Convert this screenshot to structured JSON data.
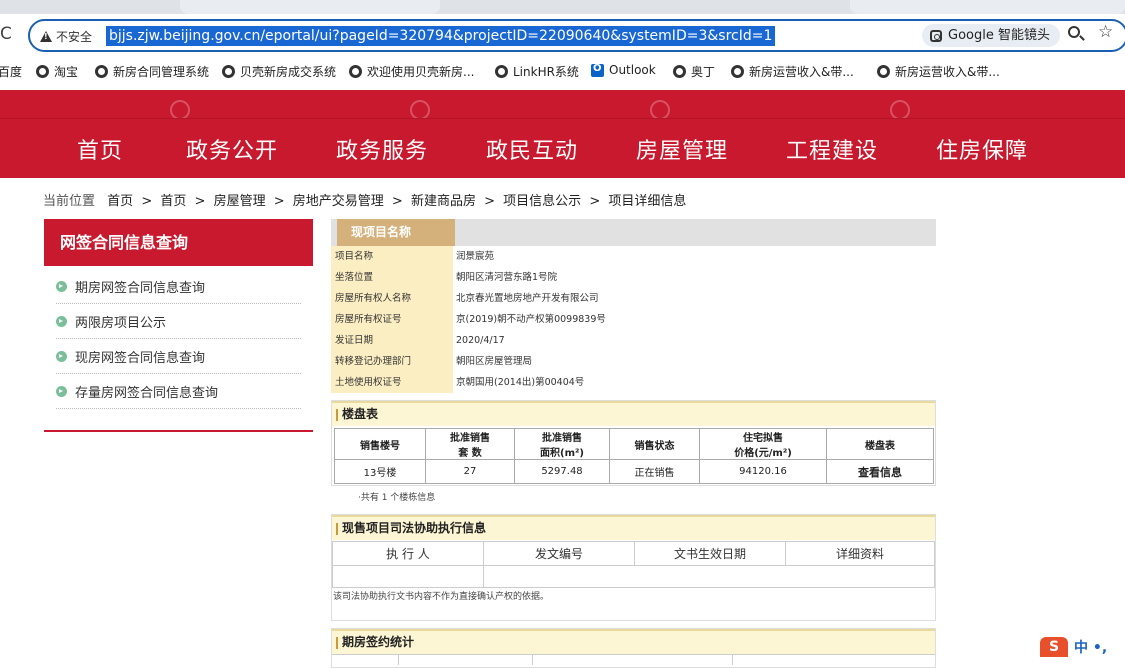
{
  "browser": {
    "security_label": "不安全",
    "url": "bjjs.zjw.beijing.gov.cn/eportal/ui?pageId=320794&projectID=22090640&systemID=3&srcId=1",
    "lens_label": "Google 智能镜头",
    "bookmarks": [
      "百度",
      "淘宝",
      "新房合同管理系统",
      "贝壳新房成交系统",
      "欢迎使用贝壳新房...",
      "LinkHR系统",
      "Outlook",
      "奥丁",
      "新房运营收入&带...",
      "新房运营收入&带..."
    ]
  },
  "nav": {
    "items": [
      "首页",
      "政务公开",
      "政务服务",
      "政民互动",
      "房屋管理",
      "工程建设",
      "住房保障"
    ]
  },
  "breadcrumb": {
    "prefix": "当前位置",
    "items": [
      "首页",
      ">",
      "首页",
      ">",
      "房屋管理",
      ">",
      "房地产交易管理",
      ">",
      "新建商品房",
      ">",
      "项目信息公示",
      ">",
      "项目详细信息"
    ]
  },
  "sidebar": {
    "title": "网签合同信息查询",
    "items": [
      "期房网签合同信息查询",
      "两限房项目公示",
      "现房网签合同信息查询",
      "存量房网签合同信息查询"
    ]
  },
  "project": {
    "tab_label": "现项目名称",
    "rows": [
      {
        "label": "项目名称",
        "value": "润景宸苑"
      },
      {
        "label": "坐落位置",
        "value": "朝阳区清河营东路1号院"
      },
      {
        "label": "房屋所有权人名称",
        "value": "北京春光置地房地产开发有限公司"
      },
      {
        "label": "房屋所有权证号",
        "value": "京(2019)朝不动产权第0099839号"
      },
      {
        "label": "发证日期",
        "value": "2020/4/17"
      },
      {
        "label": "转移登记办理部门",
        "value": "朝阳区房屋管理局"
      },
      {
        "label": "土地使用权证号",
        "value": "京朝国用(2014出)第00404号"
      }
    ]
  },
  "building_table": {
    "title": "楼盘表",
    "headers": [
      "销售楼号",
      "批准销售\n套    数",
      "批准销售\n面积(m²)",
      "销售状态",
      "住宅拟售\n价格(元/m²)",
      "楼盘表"
    ],
    "rows": [
      [
        "13号楼",
        "27",
        "5297.48",
        "正在销售",
        "94120.16",
        "查看信息"
      ]
    ],
    "footnote": "·共有 1 个楼栋信息"
  },
  "judicial": {
    "title": "现售项目司法协助执行信息",
    "headers": [
      "执 行 人",
      "发文编号",
      "文书生效日期",
      "详细资料"
    ],
    "note": "该司法协助执行文书内容不作为直接确认产权的依据。"
  },
  "stats": {
    "title": "期房签约统计"
  },
  "ime": {
    "logo": "S",
    "text": "中 •,"
  },
  "colors": {
    "brand_red": "#c9192e",
    "tab_gold": "#d4b17a",
    "label_bg": "#fbeec2",
    "url_highlight": "#1967d2"
  }
}
